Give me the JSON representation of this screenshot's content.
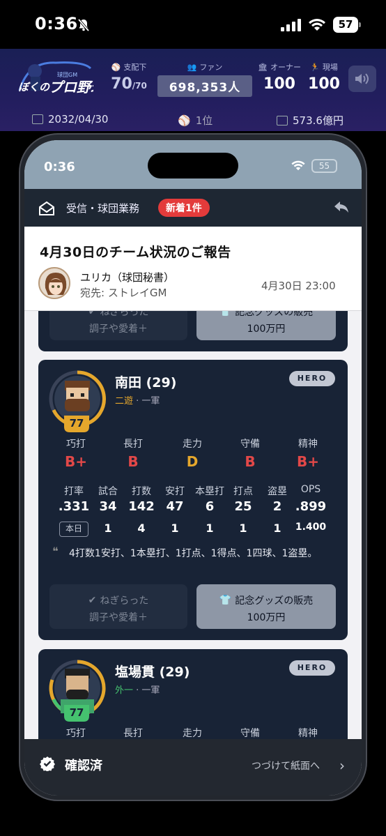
{
  "status": {
    "time": "0:36",
    "battery": "57"
  },
  "game": {
    "logo_line1": "ぼくのプロ野球",
    "logo_line2": "球団GMになろう",
    "dominion_label": "支配下",
    "dominion_value": "70",
    "dominion_max": "/70",
    "fans_label": "ファン",
    "fans_value": "698,353人",
    "owner_label": "オーナー",
    "owner_value": "100",
    "field_label": "現場",
    "field_value": "100",
    "date": "2032/04/30",
    "rank": "1位",
    "money": "573.6億円"
  },
  "inner": {
    "time": "0:36",
    "battery": "55"
  },
  "mail": {
    "header_title": "受信・球団業務",
    "badge": "新着1件",
    "subject": "4月30日のチーム状況のご報告",
    "from": "ユリカ（球団秘書）",
    "to": "宛先: ストレイGM",
    "date": "4月30日 23:00"
  },
  "card0": {
    "btn1_l1": "ねぎらった",
    "btn1_l2": "調子や愛着＋",
    "btn2_l1": "記念グッズの販売",
    "btn2_l2": "100万円"
  },
  "card1": {
    "name": "南田 (29)",
    "pos1": "二遊",
    "pos2": " · 一軍",
    "number": "77",
    "tag": "HERO",
    "abilities": [
      {
        "label": "巧打",
        "grade": "B+",
        "color": "#e24848"
      },
      {
        "label": "長打",
        "grade": "B",
        "color": "#e24848"
      },
      {
        "label": "走力",
        "grade": "D",
        "color": "#e5a72c"
      },
      {
        "label": "守備",
        "grade": "B",
        "color": "#e24848"
      },
      {
        "label": "精神",
        "grade": "B+",
        "color": "#e24848"
      }
    ],
    "stat_headers": [
      "打率",
      "試合",
      "打数",
      "安打",
      "本塁打",
      "打点",
      "盗塁",
      "OPS"
    ],
    "season": [
      ".331",
      "34",
      "142",
      "47",
      "6",
      "25",
      "2",
      ".899"
    ],
    "today_label": "本日",
    "today": [
      "1",
      "4",
      "1",
      "1",
      "1",
      "1",
      "1.400"
    ],
    "comment": "4打数1安打、1本塁打、1打点、1得点、1四球、1盗塁。",
    "btn1_l1": "ねぎらった",
    "btn1_l2": "調子や愛着＋",
    "btn2_l1": "記念グッズの販売",
    "btn2_l2": "100万円"
  },
  "card2": {
    "name": "塩場貫 (29)",
    "pos1": "外一",
    "pos2": " · 一軍",
    "number": "77",
    "tag": "HERO",
    "abilities": [
      "巧打",
      "長打",
      "走力",
      "守備",
      "精神"
    ]
  },
  "footer": {
    "confirmed": "確認済",
    "next": "つづけて紙面へ"
  }
}
